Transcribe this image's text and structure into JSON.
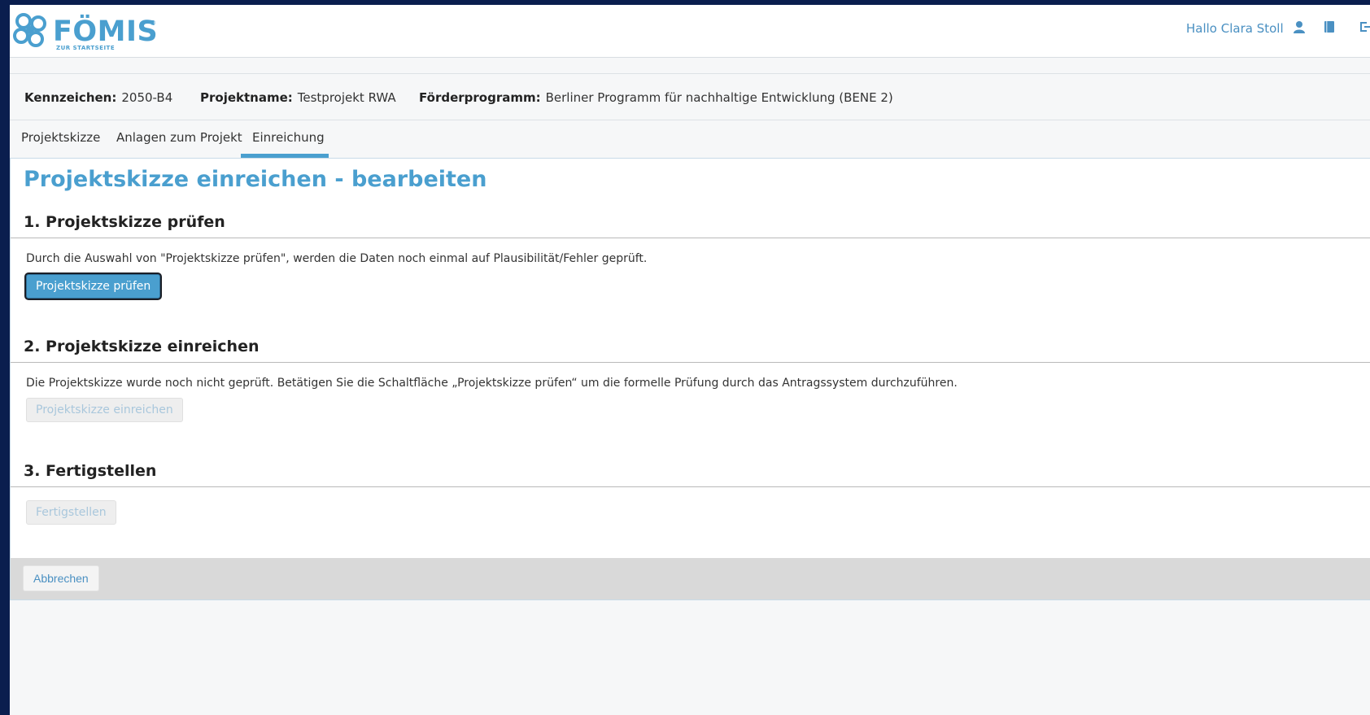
{
  "header": {
    "logo": {
      "name": "FÖMIS",
      "registered": "®",
      "subtitle": "ZUR STARTSEITE"
    },
    "greeting": "Hallo Clara Stoll",
    "icons": [
      "user-icon",
      "book-icon",
      "logout-icon"
    ]
  },
  "project_info": {
    "kennzeichen_label": "Kennzeichen:",
    "kennzeichen_value": "2050-B4",
    "projektname_label": "Projektname:",
    "projektname_value": "Testprojekt RWA",
    "foerderprogramm_label": "Förderprogramm:",
    "foerderprogramm_value": "Berliner Programm für nachhaltige Entwicklung (BENE 2)"
  },
  "tabs": [
    {
      "label": "Projektskizze",
      "active": false
    },
    {
      "label": "Anlagen zum Projekt",
      "active": false
    },
    {
      "label": "Einreichung",
      "active": true
    }
  ],
  "page": {
    "title": "Projektskizze einreichen - bearbeiten",
    "sections": [
      {
        "heading": "1. Projektskizze prüfen",
        "description": "Durch die Auswahl von \"Projektskizze prüfen\", werden die Daten noch einmal auf Plausibilität/Fehler geprüft.",
        "button": "Projektskizze prüfen",
        "button_enabled": true
      },
      {
        "heading": "2. Projektskizze einreichen",
        "description": "Die Projektskizze wurde noch nicht geprüft. Betätigen Sie die Schaltfläche „Projektskizze prüfen“ um die formelle Prüfung durch das Antragssystem durchzuführen.",
        "button": "Projektskizze einreichen",
        "button_enabled": false
      },
      {
        "heading": "3. Fertigstellen",
        "button": "Fertigstellen",
        "button_enabled": false
      }
    ],
    "cancel_button": "Abbrechen"
  },
  "colors": {
    "accent": "#4a9fcf",
    "frame": "#0a1e4e",
    "footer_bar": "#d9d9d9"
  }
}
